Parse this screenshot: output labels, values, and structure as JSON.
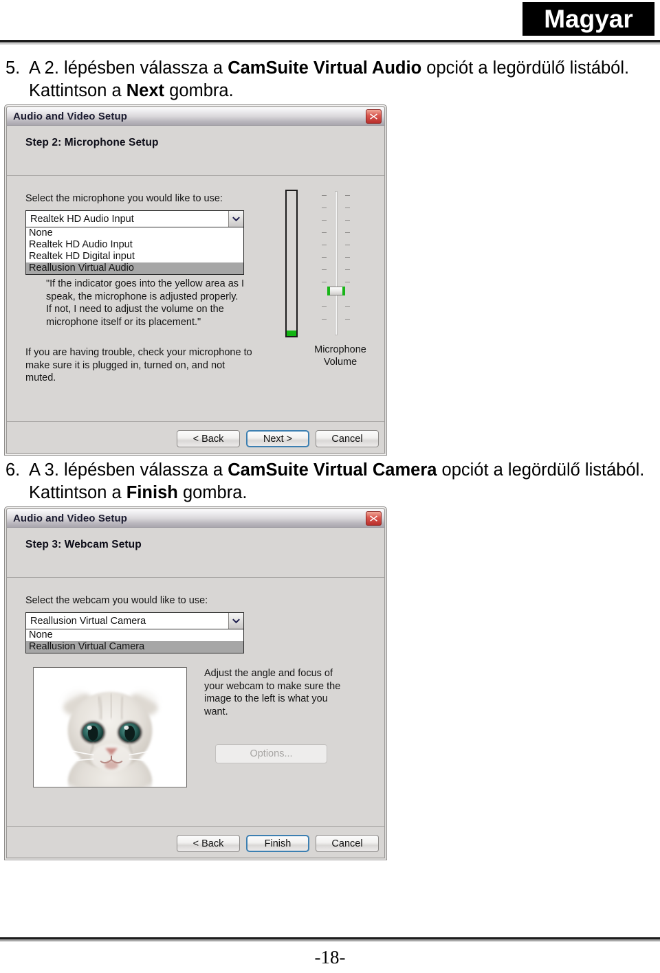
{
  "header": {
    "language_badge": "Magyar"
  },
  "footer": {
    "page_number": "-18-"
  },
  "instructions": [
    {
      "number": "5.",
      "segments": [
        {
          "text": "A 2. lépésben válassza a ",
          "bold": false
        },
        {
          "text": "CamSuite Virtual Audio",
          "bold": true
        },
        {
          "text": " opciót a legördülő listából. Kattintson a ",
          "bold": false
        },
        {
          "text": "Next",
          "bold": true
        },
        {
          "text": " gombra.",
          "bold": false
        }
      ]
    },
    {
      "number": "6.",
      "segments": [
        {
          "text": "A 3. lépésben válassza a ",
          "bold": false
        },
        {
          "text": "CamSuite Virtual Camera",
          "bold": true
        },
        {
          "text": " opciót a legördülő listából. Kattintson a ",
          "bold": false
        },
        {
          "text": "Finish",
          "bold": true
        },
        {
          "text": " gombra.",
          "bold": false
        }
      ]
    }
  ],
  "dialog_microphone": {
    "title": "Audio and Video Setup",
    "close_icon": "close-x-icon",
    "step_title": "Step 2: Microphone Setup",
    "select_label": "Select the microphone you would like to use:",
    "combo": {
      "value": "Realtek HD Audio Input",
      "arrow_icon": "chevron-down-icon",
      "options": [
        {
          "label": "None",
          "selected": false
        },
        {
          "label": "Realtek HD Audio Input",
          "selected": false
        },
        {
          "label": "Realtek HD Digital input",
          "selected": false
        },
        {
          "label": "Reallusion Virtual Audio",
          "selected": true
        }
      ]
    },
    "quote_text": "\"If the indicator goes into the yellow area as I speak, the microphone is adjusted properly.  If not, I need to adjust the volume on the microphone itself or its placement.\"",
    "trouble_text": "If you are having trouble, check your microphone to make sure it is plugged in, turned on, and not muted.",
    "volume_caption_line1": "Microphone",
    "volume_caption_line2": "Volume",
    "meter_level_percent": 4,
    "slider_position_percent": 22,
    "buttons": [
      {
        "label": "< Back",
        "default": false,
        "disabled": false
      },
      {
        "label": "Next >",
        "default": true,
        "disabled": false
      },
      {
        "label": "Cancel",
        "default": false,
        "disabled": false
      }
    ]
  },
  "dialog_webcam": {
    "title": "Audio and Video Setup",
    "close_icon": "close-x-icon",
    "step_title": "Step 3: Webcam Setup",
    "select_label": "Select the webcam you would like to use:",
    "combo": {
      "value": "Reallusion Virtual Camera",
      "arrow_icon": "chevron-down-icon",
      "options": [
        {
          "label": "None",
          "selected": false
        },
        {
          "label": "Reallusion Virtual Camera",
          "selected": true
        }
      ]
    },
    "adjust_text": "Adjust the angle and focus of your webcam to make sure the image to the left is what you want.",
    "preview_alt": "kitten-webcam-preview",
    "options_button": {
      "label": "Options...",
      "disabled": true
    },
    "buttons": [
      {
        "label": "< Back",
        "default": false,
        "disabled": false
      },
      {
        "label": "Finish",
        "default": true,
        "disabled": false
      },
      {
        "label": "Cancel",
        "default": false,
        "disabled": false
      }
    ]
  },
  "colors": {
    "badge_background": "#000000",
    "badge_text": "#ffffff",
    "dialog_face": "#d8d6d4",
    "close_button": "#c0392b",
    "selection_highlight": "#a6a6a6",
    "meter_green": "#13b513",
    "default_button_focus": "#3c7fb1"
  }
}
